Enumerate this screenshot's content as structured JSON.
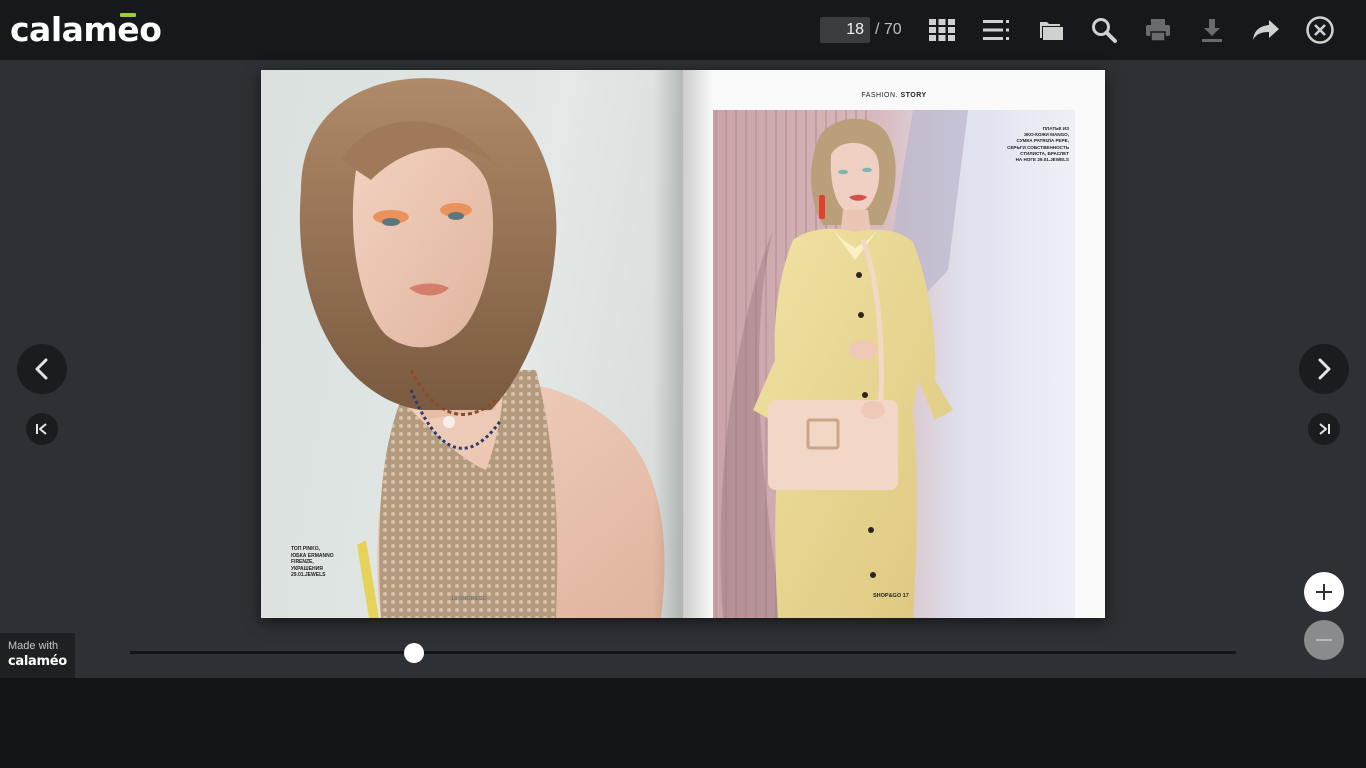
{
  "header": {
    "logo": {
      "text_prefix": "calam",
      "text_accent": "e",
      "text_suffix": "o"
    },
    "page_input_value": "18",
    "page_total": "/ 70",
    "toolbar_icons": [
      "thumbnails-grid-icon",
      "table-of-contents-icon",
      "folder-icon",
      "search-icon",
      "print-icon",
      "download-icon",
      "share-icon",
      "close-icon"
    ]
  },
  "spread": {
    "left_page": {
      "caption": "ТОП PINKO,\nЮБКА ERMANNO\nFIRENZE,\nУКРАШЕНИЯ\n29.01.JEWELS",
      "folio": "18 SHOP&GO"
    },
    "right_page": {
      "section_prefix": "FASHION.",
      "section_bold": "STORY",
      "caption": "ПЛАТЬЕ ИЗ\nЭКО-КОЖИ MANGO,\nСУМКА PATRIZIA PEPE,\nСЕРЬГИ СОБСТВЕННОСТЬ\nСТИЛИСТА, БРАСЛЕТ\nНА НОГЕ 29.01.JEWELS",
      "folio": "SHOP&GO 17"
    }
  },
  "navigation": {
    "prev_icon": "chevron-left-icon",
    "next_icon": "chevron-right-icon",
    "first_icon": "first-page-icon",
    "last_icon": "last-page-icon"
  },
  "zoom": {
    "in_icon": "plus-icon",
    "out_icon": "minus-icon"
  },
  "slider": {
    "fraction": 0.257
  },
  "footer": {
    "made_with_label": "Made with",
    "made_with_logo": "calaméo"
  },
  "colors": {
    "topbar": "#17181b",
    "stage": "#2d3034",
    "accent": "#9ccb3b",
    "icon": "#d0d0d0",
    "icon_disabled": "#6a6b6e"
  }
}
